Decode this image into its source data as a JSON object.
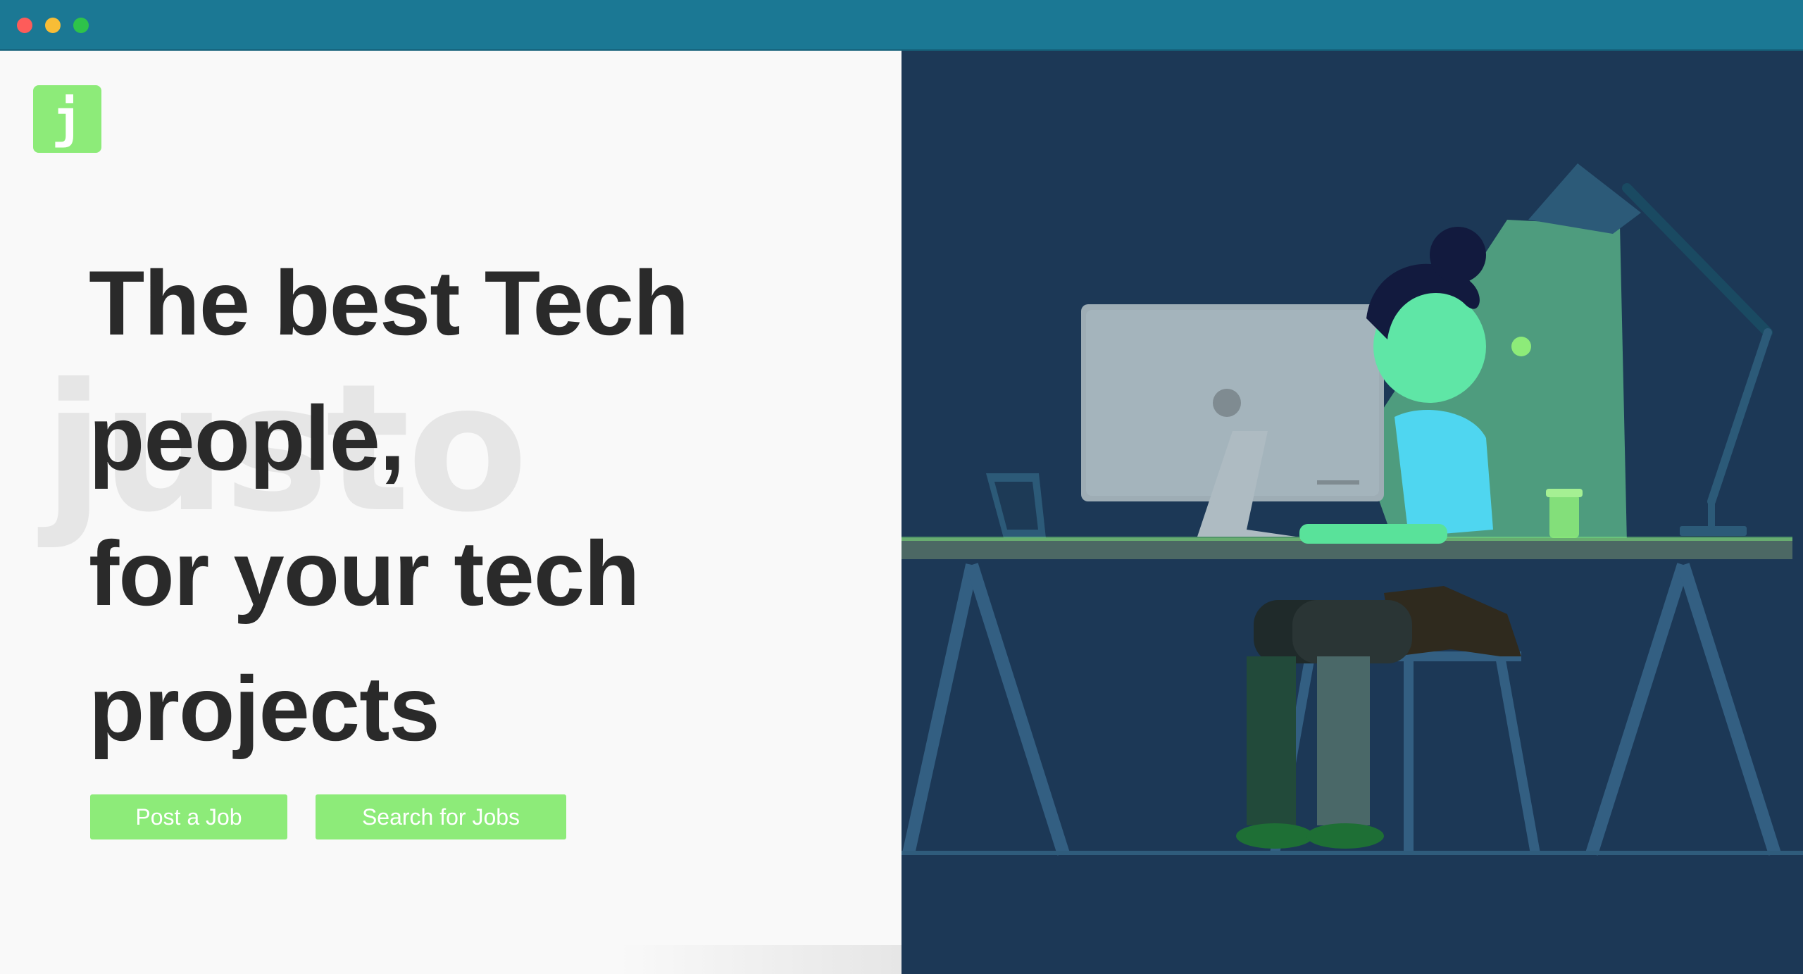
{
  "window": {
    "controls": [
      "close",
      "minimize",
      "zoom"
    ],
    "colors": {
      "titlebar": "#1b7894",
      "close": "#fd5c5a",
      "minimize": "#f8bd36",
      "zoom": "#2ec34a"
    }
  },
  "brand": {
    "logo_letter": "j",
    "watermark": "justo",
    "accent_color": "#8deb79"
  },
  "hero": {
    "headline_lines": [
      "The best Tech",
      "people,",
      "for your tech",
      "projects"
    ]
  },
  "actions": {
    "post_job_label": "Post a Job",
    "search_jobs_label": "Search for Jobs"
  },
  "illustration": {
    "subject": "person-at-desk-with-computer-and-lamp",
    "background_color": "#1c3856"
  }
}
